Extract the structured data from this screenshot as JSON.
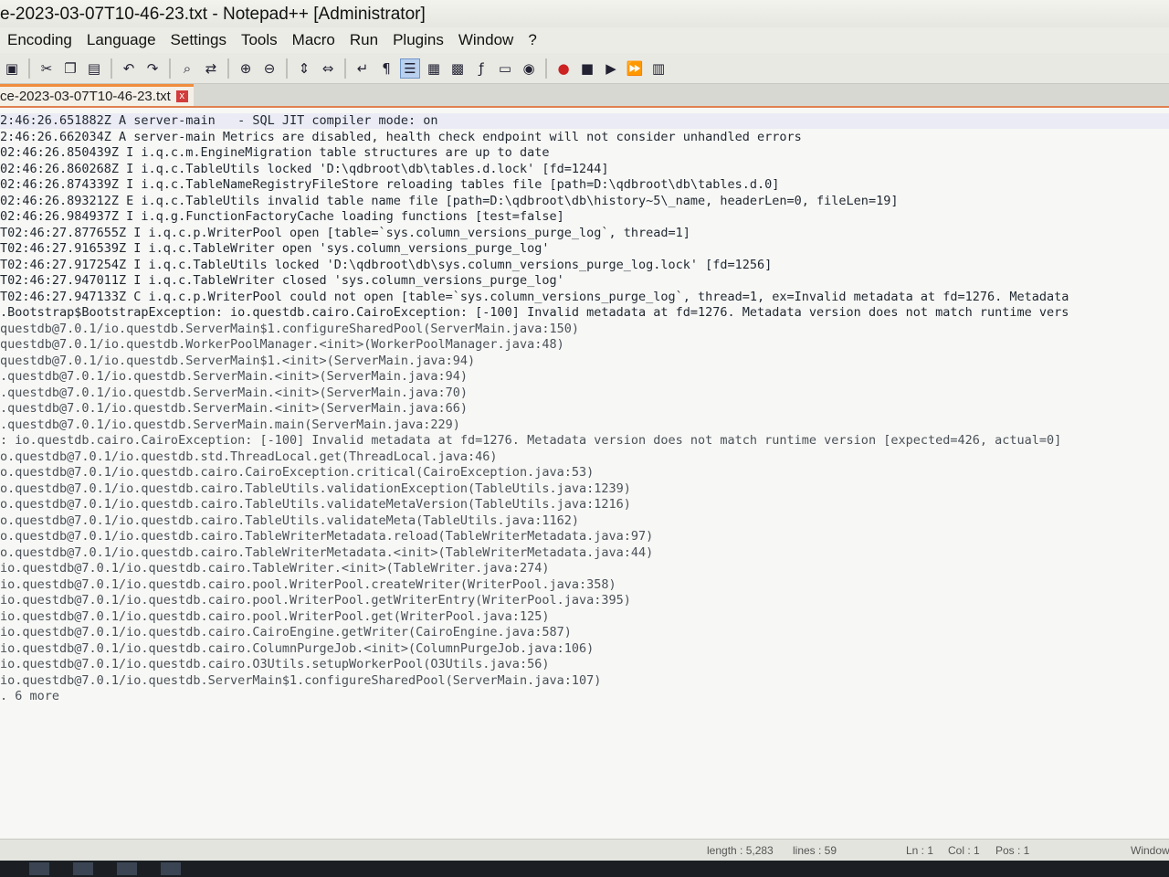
{
  "window": {
    "title": "e-2023-03-07T10-46-23.txt - Notepad++ [Administrator]"
  },
  "menu": [
    "Encoding",
    "Language",
    "Settings",
    "Tools",
    "Macro",
    "Run",
    "Plugins",
    "Window",
    "?"
  ],
  "toolbar_icons": [
    "save-all-icon",
    "cut-icon",
    "copy-icon",
    "paste-icon",
    "undo-icon",
    "redo-icon",
    "find-icon",
    "replace-icon",
    "zoom-in-icon",
    "zoom-out-icon",
    "sync-v-icon",
    "sync-h-icon",
    "word-wrap-icon",
    "show-all-chars-icon",
    "indent-guide-icon",
    "lang-icon",
    "doc-map-icon",
    "function-list-icon",
    "folder-workspace-icon",
    "monitor-icon",
    "record-macro-icon",
    "stop-macro-icon",
    "play-macro-icon",
    "run-multiple-macro-icon",
    "save-macro-icon"
  ],
  "tab": {
    "label": "ce-2023-03-07T10-46-23.txt",
    "close": "x"
  },
  "lines": [
    "2:46:26.651882Z A server-main   - SQL JIT compiler mode: on",
    "2:46:26.662034Z A server-main Metrics are disabled, health check endpoint will not consider unhandled errors",
    "02:46:26.850439Z I i.q.c.m.EngineMigration table structures are up to date",
    "02:46:26.860268Z I i.q.c.TableUtils locked 'D:\\qdbroot\\db\\tables.d.lock' [fd=1244]",
    "02:46:26.874339Z I i.q.c.TableNameRegistryFileStore reloading tables file [path=D:\\qdbroot\\db\\tables.d.0]",
    "02:46:26.893212Z E i.q.c.TableUtils invalid table name file [path=D:\\qdbroot\\db\\history~5\\_name, headerLen=0, fileLen=19]",
    "02:46:26.984937Z I i.q.g.FunctionFactoryCache loading functions [test=false]",
    "T02:46:27.877655Z I i.q.c.p.WriterPool open [table=`sys.column_versions_purge_log`, thread=1]",
    "T02:46:27.916539Z I i.q.c.TableWriter open 'sys.column_versions_purge_log'",
    "T02:46:27.917254Z I i.q.c.TableUtils locked 'D:\\qdbroot\\db\\sys.column_versions_purge_log.lock' [fd=1256]",
    "T02:46:27.947011Z I i.q.c.TableWriter closed 'sys.column_versions_purge_log'",
    "T02:46:27.947133Z C i.q.c.p.WriterPool could not open [table=`sys.column_versions_purge_log`, thread=1, ex=Invalid metadata at fd=1276. Metadata",
    ".Bootstrap$BootstrapException: io.questdb.cairo.CairoException: [-100] Invalid metadata at fd=1276. Metadata version does not match runtime vers",
    "questdb@7.0.1/io.questdb.ServerMain$1.configureSharedPool(ServerMain.java:150)",
    "questdb@7.0.1/io.questdb.WorkerPoolManager.<init>(WorkerPoolManager.java:48)",
    "questdb@7.0.1/io.questdb.ServerMain$1.<init>(ServerMain.java:94)",
    ".questdb@7.0.1/io.questdb.ServerMain.<init>(ServerMain.java:94)",
    ".questdb@7.0.1/io.questdb.ServerMain.<init>(ServerMain.java:70)",
    ".questdb@7.0.1/io.questdb.ServerMain.<init>(ServerMain.java:66)",
    ".questdb@7.0.1/io.questdb.ServerMain.main(ServerMain.java:229)",
    ": io.questdb.cairo.CairoException: [-100] Invalid metadata at fd=1276. Metadata version does not match runtime version [expected=426, actual=0]",
    "o.questdb@7.0.1/io.questdb.std.ThreadLocal.get(ThreadLocal.java:46)",
    "o.questdb@7.0.1/io.questdb.cairo.CairoException.critical(CairoException.java:53)",
    "o.questdb@7.0.1/io.questdb.cairo.TableUtils.validationException(TableUtils.java:1239)",
    "o.questdb@7.0.1/io.questdb.cairo.TableUtils.validateMetaVersion(TableUtils.java:1216)",
    "o.questdb@7.0.1/io.questdb.cairo.TableUtils.validateMeta(TableUtils.java:1162)",
    "o.questdb@7.0.1/io.questdb.cairo.TableWriterMetadata.reload(TableWriterMetadata.java:97)",
    "o.questdb@7.0.1/io.questdb.cairo.TableWriterMetadata.<init>(TableWriterMetadata.java:44)",
    "io.questdb@7.0.1/io.questdb.cairo.TableWriter.<init>(TableWriter.java:274)",
    "io.questdb@7.0.1/io.questdb.cairo.pool.WriterPool.createWriter(WriterPool.java:358)",
    "io.questdb@7.0.1/io.questdb.cairo.pool.WriterPool.getWriterEntry(WriterPool.java:395)",
    "io.questdb@7.0.1/io.questdb.cairo.pool.WriterPool.get(WriterPool.java:125)",
    "io.questdb@7.0.1/io.questdb.cairo.CairoEngine.getWriter(CairoEngine.java:587)",
    "io.questdb@7.0.1/io.questdb.cairo.ColumnPurgeJob.<init>(ColumnPurgeJob.java:106)",
    "io.questdb@7.0.1/io.questdb.cairo.O3Utils.setupWorkerPool(O3Utils.java:56)",
    "io.questdb@7.0.1/io.questdb.ServerMain$1.configureSharedPool(ServerMain.java:107)",
    ". 6 more"
  ],
  "status": {
    "length": "length : 5,283",
    "lines": "lines : 59",
    "ln": "Ln : 1",
    "col": "Col : 1",
    "pos": "Pos : 1",
    "eol": "Window"
  },
  "colors": {
    "tab_accent": "#f08c3c",
    "close_red": "#d23c3c",
    "active_icon": "#b9d0ee"
  }
}
